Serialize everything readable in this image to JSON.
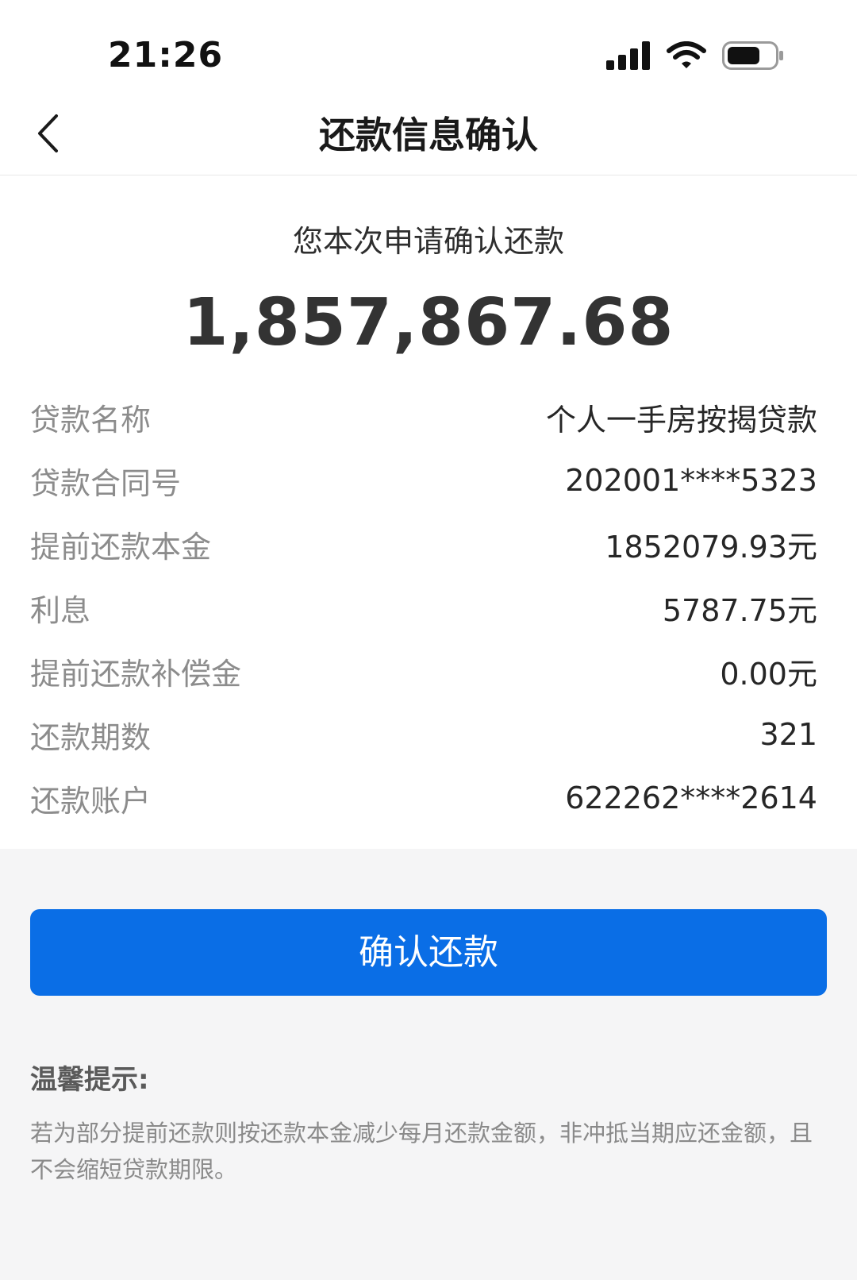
{
  "status_bar": {
    "time": "21:26",
    "icons": [
      "signal-icon",
      "wifi-icon",
      "battery-icon"
    ]
  },
  "nav": {
    "back_icon": "chevron-left-icon",
    "title": "还款信息确认"
  },
  "summary": {
    "caption": "您本次申请确认还款",
    "amount": "1,857,867.68"
  },
  "details": [
    {
      "label": "贷款名称",
      "value": "个人一手房按揭贷款"
    },
    {
      "label": "贷款合同号",
      "value": "202001****5323"
    },
    {
      "label": "提前还款本金",
      "value": "1852079.93元"
    },
    {
      "label": "利息",
      "value": "5787.75元"
    },
    {
      "label": "提前还款补偿金",
      "value": "0.00元"
    },
    {
      "label": "还款期数",
      "value": "321"
    },
    {
      "label": "还款账户",
      "value": "622262****2614"
    }
  ],
  "actions": {
    "confirm_label": "确认还款"
  },
  "tips": {
    "title": "温馨提示:",
    "body": "若为部分提前还款则按还款本金减少每月还款金额，非冲抵当期应还金额，且不会缩短贷款期限。"
  },
  "colors": {
    "primary": "#0a6ee6",
    "page_bg": "#f5f5f6",
    "label": "#8c8c8c"
  }
}
